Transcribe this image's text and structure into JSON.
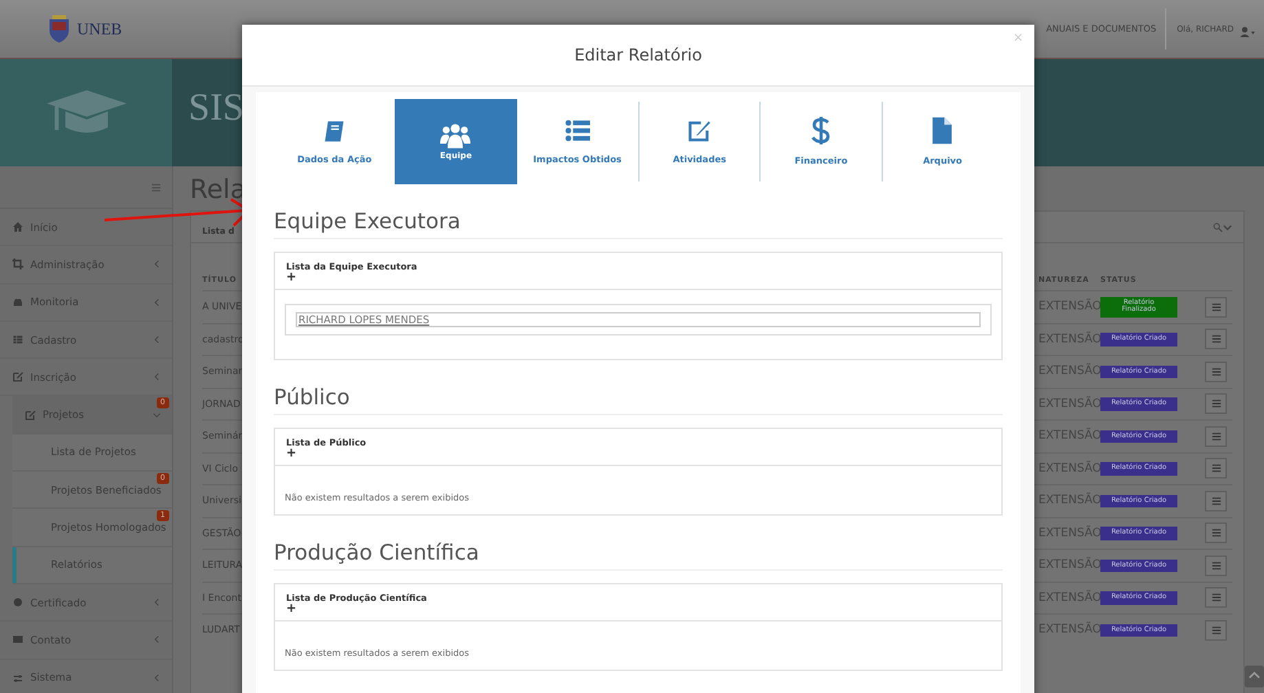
{
  "header": {
    "logo_text": "UNEB",
    "nav_link": "ANUAIS E DOCUMENTOS",
    "greeting": "Olá, RICHARD"
  },
  "banner": {
    "title": "SIS"
  },
  "sidebar": {
    "items": [
      {
        "label": "Início",
        "kind": "link",
        "selected": false
      },
      {
        "label": "Administração",
        "kind": "group",
        "expanded": false,
        "selected": false
      },
      {
        "label": "Monitoria",
        "kind": "group",
        "expanded": false,
        "selected": false
      },
      {
        "label": "Cadastro",
        "kind": "group",
        "expanded": false,
        "selected": false
      },
      {
        "label": "Inscrição",
        "kind": "group",
        "expanded": false,
        "selected": false
      },
      {
        "label": "Projetos",
        "kind": "subgroup",
        "expanded": true,
        "selected": false,
        "badge": "0"
      },
      {
        "label": "Lista de Projetos",
        "kind": "subitem",
        "selected": false
      },
      {
        "label": "Projetos Beneficiados",
        "kind": "subitem",
        "selected": false,
        "badge": "0"
      },
      {
        "label": "Projetos Homologados",
        "kind": "subitem",
        "selected": false,
        "badge": "1"
      },
      {
        "label": "Relatórios",
        "kind": "subitem",
        "selected": true
      },
      {
        "label": "Certificado",
        "kind": "group",
        "expanded": false,
        "selected": false
      },
      {
        "label": "Contato",
        "kind": "group",
        "expanded": false,
        "selected": false
      },
      {
        "label": "Sistema",
        "kind": "group",
        "expanded": false,
        "selected": false
      }
    ]
  },
  "page": {
    "title": "Rela",
    "panel_title": "Lista d",
    "table": {
      "columns": [
        "TÍTULO",
        "NATUREZA",
        "STATUS"
      ],
      "rows": [
        {
          "title": "A UNIVE",
          "natureza": "EXTENSÃO",
          "status": "Relatório Finalizado",
          "color": "#0b6e0b"
        },
        {
          "title": "cadastro",
          "natureza": "EXTENSÃO",
          "status": "Relatório Criado",
          "color": "#3b2f8c"
        },
        {
          "title": "Seminar",
          "natureza": "EXTENSÃO",
          "status": "Relatório Criado",
          "color": "#3b2f8c"
        },
        {
          "title": "JORNAD",
          "natureza": "EXTENSÃO",
          "status": "Relatório Criado",
          "color": "#3b2f8c"
        },
        {
          "title": "Seminár",
          "natureza": "EXTENSÃO",
          "status": "Relatório Criado",
          "color": "#3b2f8c"
        },
        {
          "title": "VI Ciclo",
          "natureza": "EXTENSÃO",
          "status": "Relatório Criado",
          "color": "#3b2f8c"
        },
        {
          "title": "Universi",
          "natureza": "EXTENSÃO",
          "status": "Relatório Criado",
          "color": "#3b2f8c"
        },
        {
          "title": "GESTÃO",
          "natureza": "EXTENSÃO",
          "status": "Relatório Criado",
          "color": "#3b2f8c"
        },
        {
          "title": "LEITURA",
          "natureza": "EXTENSÃO",
          "status": "Relatório Criado",
          "color": "#3b2f8c"
        },
        {
          "title": "I Encont",
          "natureza": "EXTENSÃO",
          "status": "Relatório Criado",
          "color": "#3b2f8c"
        },
        {
          "title": "LUDART",
          "natureza": "EXTENSÃO",
          "status": "Relatório Criado",
          "color": "#3b2f8c"
        }
      ]
    }
  },
  "modal": {
    "title": "Editar Relatório",
    "close": "×",
    "tabs": [
      {
        "label": "Dados da Ação",
        "selected": false
      },
      {
        "label": "Equipe",
        "selected": true
      },
      {
        "label": "Impactos Obtidos",
        "selected": false
      },
      {
        "label": "Atividades",
        "selected": false
      },
      {
        "label": "Financeiro",
        "selected": false
      },
      {
        "label": "Arquivo",
        "selected": false
      }
    ],
    "sections": [
      {
        "heading": "Equipe Executora",
        "list_title": "Lista da Equipe Executora",
        "add": "+",
        "kind": "members",
        "members": [
          "RICHARD LOPES MENDES"
        ]
      },
      {
        "heading": "Público",
        "list_title": "Lista de Público",
        "add": "+",
        "kind": "empty",
        "empty_text": "Não existem resultados a serem exibidos"
      },
      {
        "heading": "Produção Científica",
        "list_title": "Lista de Produção Científica",
        "add": "+",
        "kind": "empty",
        "empty_text": "Não existem resultados a serem exibidos"
      }
    ]
  }
}
